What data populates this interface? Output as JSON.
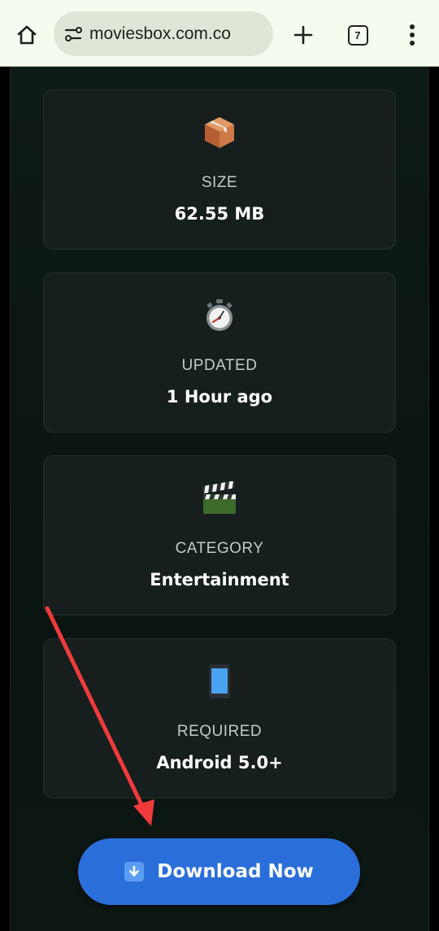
{
  "browser": {
    "url": "moviesbox.com.co",
    "tab_count": "7",
    "icons": {
      "home": "home-icon",
      "site_info": "site-settings-icon",
      "new_tab": "plus-icon",
      "menu": "more-vertical-icon"
    }
  },
  "info_cards": [
    {
      "icon": "package-icon",
      "label": "SIZE",
      "value": "62.55 MB"
    },
    {
      "icon": "stopwatch-icon",
      "label": "UPDATED",
      "value": "1 Hour ago"
    },
    {
      "icon": "clapperboard-icon",
      "label": "CATEGORY",
      "value": "Entertainment"
    },
    {
      "icon": "mobile-phone-icon",
      "label": "REQUIRED",
      "value": "Android 5.0+"
    }
  ],
  "download": {
    "label": "Download Now",
    "icon": "down-arrow-button-icon"
  },
  "colors": {
    "toolbar_bg": "#f6fbef",
    "page_bg": "#0b1210",
    "card_bg": "#161f1d",
    "button_bg": "#2a6fd9",
    "annotation_arrow": "#ef3b3b"
  }
}
